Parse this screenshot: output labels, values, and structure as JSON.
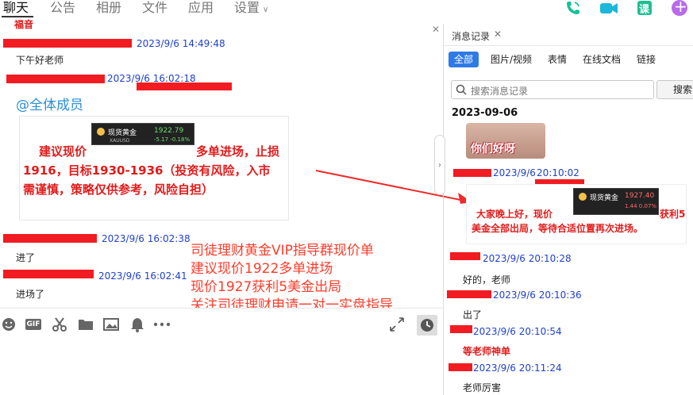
{
  "nav": {
    "tabs": [
      "聊天",
      "公告",
      "相册",
      "文件",
      "应用",
      "设置"
    ],
    "active": "聊天",
    "right_icons": [
      "phone-icon",
      "video-icon",
      "course-icon",
      "add-icon"
    ],
    "right_icon_labels": {
      "course": "课",
      "add": "+"
    }
  },
  "chat": {
    "top_partial_text": "福音",
    "messages": [
      {
        "time": "2023/9/6 14:49:48",
        "text": "下午好老师"
      },
      {
        "time": "2023/9/6 16:02:18",
        "mention": "@全体成员",
        "image": {
          "ticker_name": "现货黄金",
          "ticker_code": "XAUUSD",
          "ticker_price": "1922.79",
          "ticker_change": "-5.17  -0.18%",
          "line1a": "建议现价",
          "line1b": "多单进场，止损",
          "line2": "1916，目标1930-1936（投资有风险，入市",
          "line3": "需谨慎，策略仅供参考，风险自担）"
        }
      },
      {
        "time": "2023/9/6 16:02:38",
        "text": "进了"
      },
      {
        "time": "2023/9/6 16:02:41",
        "text": "进场了"
      }
    ],
    "overlay_lines": [
      "司徒理财黄金VIP指导群现价单",
      "建议现价1922多单进场",
      "现价1927获利5美金出局",
      "关注司徒理财申请一对一实盘指导"
    ]
  },
  "toolbar": {
    "icons": [
      "emoji-icon",
      "gif-icon",
      "scissors-icon",
      "folder-icon",
      "image-icon",
      "bell-icon",
      "more-icon"
    ],
    "gif_label": "GIF",
    "right_icons": [
      "expand-icon",
      "history-icon"
    ]
  },
  "history": {
    "title": "消息记录",
    "filters": [
      "全部",
      "图片/视频",
      "表情",
      "在线文档",
      "链接"
    ],
    "active_filter": "全部",
    "search_placeholder": "搜索消息记录",
    "search_button": "搜索",
    "date": "2023-09-06",
    "thumb_caption": "你们好呀",
    "entries": [
      {
        "time_a": "2023/9/6",
        "time_b": "20:10:02",
        "card": {
          "ticker_name": "现货黄金",
          "ticker_price": "1927.40",
          "ticker_change": "1.44  0.07%",
          "line1a": "大家晚上好，现价",
          "line1b": "获利5",
          "line2": "美金全部出局，等待合适位置再次进场。"
        }
      },
      {
        "time": "2023/9/6 20:10:28",
        "text": "好的，老师"
      },
      {
        "time": "2023/9/6 20:10:36",
        "text": "出了"
      },
      {
        "time": "2023/9/6 20:10:54",
        "bold": "等老师神单"
      },
      {
        "time": "2023/9/6 20:11:24",
        "text": "老师厉害"
      }
    ]
  },
  "colors": {
    "accent": "#2f7be6",
    "redact": "#f01c22",
    "meta_blue": "#1f3fd0",
    "overlay_red": "#ff3b2a",
    "phone_green": "#16c29a",
    "video_teal": "#1bb8d9",
    "course_green": "#1fbf8f",
    "add_purple": "#b86be8"
  }
}
